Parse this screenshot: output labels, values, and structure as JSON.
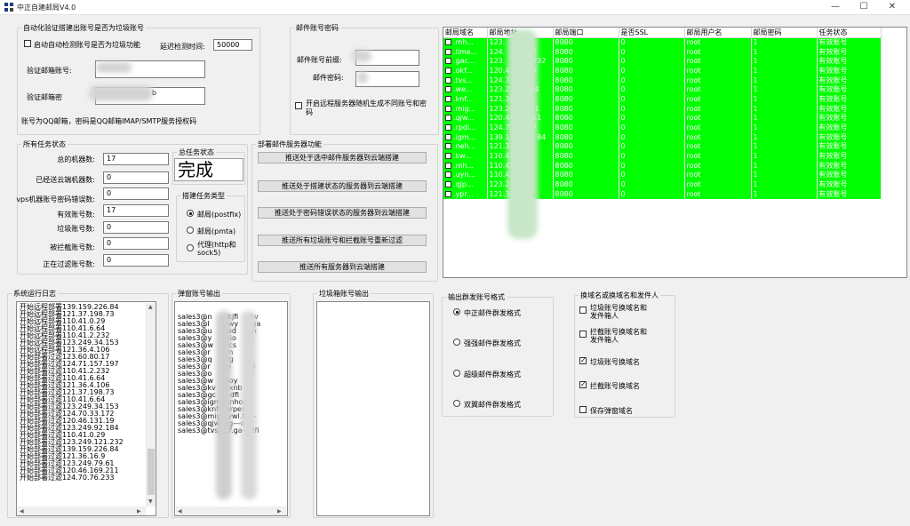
{
  "window": {
    "title": "中正自建邮局V4.0",
    "minimize": "—",
    "maximize": "☐",
    "close": "✕"
  },
  "auto_check": {
    "legend": "自动化验证搭建出账号是否为垃圾账号",
    "enable_label": "启动自动检测账号是否为垃圾功能",
    "enabled": false,
    "delay_label": "延迟检测时间:",
    "delay_value": "50000",
    "verify_email_label": "验证邮箱账号:",
    "verify_email_value": "",
    "verify_pwd_label": "验证邮箱密",
    "verify_pwd_value": "b",
    "note": "账号为QQ邮箱，密码是QQ邮箱IMAP/SMTP服务授权码"
  },
  "mail_account": {
    "legend": "邮件账号密码",
    "prefix_label": "邮件账号前缀:",
    "prefix_value": "",
    "pwd_label": "邮件密码:",
    "pwd_value": "",
    "random_label": "开启远程服务器随机生成不同账号和密码",
    "random_enabled": false
  },
  "task_status": {
    "legend": "所有任务状态",
    "rows": [
      {
        "label": "总的机器数:",
        "value": "17"
      },
      {
        "label": "已经送云端机器数:",
        "value": "0"
      },
      {
        "label": "vps机器账号密码错误数:",
        "value": "0"
      },
      {
        "label": "有效账号数:",
        "value": "17"
      },
      {
        "label": "垃圾账号数:",
        "value": "0"
      },
      {
        "label": "被拦截账号数:",
        "value": "0"
      },
      {
        "label": "正在过滤账号数:",
        "value": "0"
      }
    ],
    "total_legend": "总任务状态",
    "total_value": "完成",
    "type_legend": "搭建任务类型",
    "types": [
      {
        "label": "邮局(postfix)",
        "selected": true
      },
      {
        "label": "邮局(pmta)",
        "selected": false
      },
      {
        "label": "代理(http和sock5)",
        "selected": false
      }
    ]
  },
  "deploy": {
    "legend": "部署邮件服务器功能",
    "buttons": [
      "推送处于选中邮件服务器到云端搭建",
      "推送处于搭建状态的服务器到云端搭建",
      "推送处于密码错误状态的服务器到云端搭建",
      "推送所有垃圾账号和拦截账号重新过滤",
      "推送所有服务器到云端搭建"
    ]
  },
  "grid": {
    "columns": [
      "邮局域名",
      "邮局地址",
      "邮局端口",
      "是否SSL",
      "邮局用户名",
      "邮局密码",
      "任务状态"
    ],
    "rows": [
      {
        "domain": ".mh...",
        "addr": "123.",
        "addr2": ".17",
        "port": "8080",
        "ssl": "0",
        "user": "root",
        "pwd": "1",
        "status": "有效账号"
      },
      {
        "domain": ".lime...",
        "addr": "124.",
        "addr2": ".197",
        "port": "8080",
        "ssl": "0",
        "user": "root",
        "pwd": "1",
        "status": "有效账号"
      },
      {
        "domain": ".gac...",
        "addr": "123.",
        "addr2": "21.232",
        "port": "8080",
        "ssl": "0",
        "user": "root",
        "pwd": "1",
        "status": "有效账号"
      },
      {
        "domain": ".okf...",
        "addr": "120.4",
        "addr2": ".19",
        "port": "8080",
        "ssl": "0",
        "user": "root",
        "pwd": "1",
        "status": "有效账号"
      },
      {
        "domain": ".tvs...",
        "addr": "124.7",
        "addr2": "33",
        "port": "8080",
        "ssl": "0",
        "user": "root",
        "pwd": "1",
        "status": "有效账号"
      },
      {
        "domain": ".we...",
        "addr": "123.2",
        "addr2": "184",
        "port": "8080",
        "ssl": "0",
        "user": "root",
        "pwd": "1",
        "status": "有效账号"
      },
      {
        "domain": ".knf...",
        "addr": "121.36",
        "addr2": "",
        "port": "8080",
        "ssl": "0",
        "user": "root",
        "pwd": "1",
        "status": "有效账号"
      },
      {
        "domain": ".mig...",
        "addr": "123.24",
        "addr2": "51",
        "port": "8080",
        "ssl": "0",
        "user": "root",
        "pwd": "1",
        "status": "有效账号"
      },
      {
        "domain": ".qjw...",
        "addr": "120.46.",
        "addr2": "11",
        "port": "8080",
        "ssl": "0",
        "user": "root",
        "pwd": "1",
        "status": "有效账号"
      },
      {
        "domain": ".rpdi...",
        "addr": "124.70.",
        "addr2": "2",
        "port": "8080",
        "ssl": "0",
        "user": "root",
        "pwd": "1",
        "status": "有效账号"
      },
      {
        "domain": ".igm...",
        "addr": "139.159.",
        "addr2": "84",
        "port": "8080",
        "ssl": "0",
        "user": "root",
        "pwd": "1",
        "status": "有效账号"
      },
      {
        "domain": ".neh...",
        "addr": "121.37.1",
        "addr2": "",
        "port": "8080",
        "ssl": "0",
        "user": "root",
        "pwd": "1",
        "status": "有效账号"
      },
      {
        "domain": ".kw...",
        "addr": "110.41.0",
        "addr2": "",
        "port": "8080",
        "ssl": "0",
        "user": "root",
        "pwd": "1",
        "status": "有效账号"
      },
      {
        "domain": ".mh...",
        "addr": "110.41.0",
        "addr2": "",
        "port": "8080",
        "ssl": "0",
        "user": "root",
        "pwd": "1",
        "status": "有效账号"
      },
      {
        "domain": ".uyn...",
        "addr": "110.41.",
        "addr2": "",
        "port": "8080",
        "ssl": "0",
        "user": "root",
        "pwd": "1",
        "status": "有效账号"
      },
      {
        "domain": ".qjp...",
        "addr": "123.249.",
        "addr2": "",
        "port": "8080",
        "ssl": "0",
        "user": "root",
        "pwd": "1",
        "status": "有效账号"
      },
      {
        "domain": ".ypr...",
        "addr": "121.36.4",
        "addr2": "",
        "port": "8080",
        "ssl": "0",
        "user": "root",
        "pwd": "1",
        "status": "有效账号"
      }
    ]
  },
  "system_log": {
    "legend": "系统运行日志",
    "lines": [
      "开始远程部署139.159.226.84",
      "开始远程部署121.37.198.73",
      "开始远程部署110.41.0.29",
      "开始远程部署110.41.6.64",
      "开始远程部署110.41.2.232",
      "开始远程部署123.249.34.153",
      "开始远程部署121.36.4.106",
      "开始部署过滤123.60.80.17",
      "开始部署过滤124.71.157.197",
      "开始部署过滤110.41.2.232",
      "开始部署过滤110.41.6.64",
      "开始部署过滤121.36.4.106",
      "开始部署过滤121.37.198.73",
      "开始部署过滤110.41.6.64",
      "开始部署过滤123.249.34.153",
      "开始部署过滤124.70.33.172",
      "开始部署过滤120.46.131.19",
      "开始部署过滤123.249.92.184",
      "开始部署过滤110.41.0.29",
      "开始部署过滤123.249.121.232",
      "开始部署过滤139.159.226.84",
      "开始部署过滤121.36.16.9",
      "开始部署过滤123.249.79.61",
      "开始部署过滤120.46.169.211",
      "开始部署过滤124.70.76.233"
    ]
  },
  "popup_output": {
    "legend": "弹窗账号输出",
    "lines": [
      "sales3@n     ukjfi     hv",
      "sales3@l     nrwy      ga",
      "sales3@u     yod       n",
      "sales3@y     mio       -",
      "sales3@w     ycs",
      "sales3@r     dm",
      "sales3@q     rtg       t",
      "sales3@r     rpi       xn",
      "sales3@o     i         dfi",
      "sales3@w     doy",
      "sales3@kv    vxnb",
      "sales3@gc    --dfi",
      "sales3@igm   lnhoof",
      "sales3@knf   urpen",
      "sales3@mig   ywl.tk---",
      "sales3@qjw   jg---dfd",
      "sales3@tvsj  gf.ga---dfi"
    ]
  },
  "junk_output": {
    "legend": "垃圾箱账号输出",
    "lines": []
  },
  "send_format": {
    "legend": "输出群发账号格式",
    "options": [
      {
        "label": "中正邮件群发格式",
        "selected": true
      },
      {
        "label": "强强邮件群发格式",
        "selected": false
      },
      {
        "label": "超级邮件群发格式",
        "selected": false
      },
      {
        "label": "双翼邮件群发格式",
        "selected": false
      }
    ]
  },
  "replace": {
    "legend": "换域名或换域名和发件人",
    "options": [
      {
        "label": "垃圾账号换域名和发件箱人",
        "checked": false
      },
      {
        "label": "拦截账号换域名和发件箱人",
        "checked": false
      },
      {
        "label": "垃圾账号换域名",
        "checked": true
      },
      {
        "label": "拦截账号换域名",
        "checked": true
      },
      {
        "label": "保存弹窗域名",
        "checked": false
      }
    ]
  },
  "glyphs": {
    "check": "✓",
    "up": "▲",
    "down": "▼",
    "left": "◀",
    "right": "▶"
  }
}
